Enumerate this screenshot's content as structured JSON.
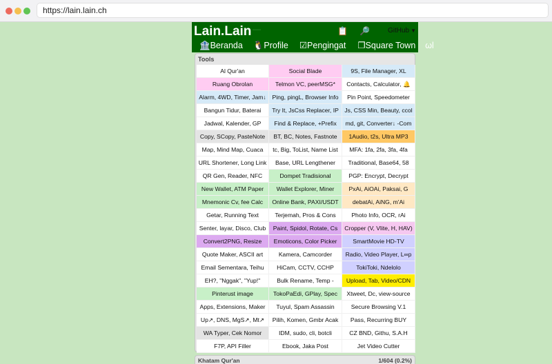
{
  "browser": {
    "url": "https://lain.lain.ch",
    "dots": [
      "#ed6a5e",
      "#f5bf4f",
      "#61c554"
    ]
  },
  "header": {
    "brand": "Lain.Lain",
    "brand_dash": "—",
    "clipboard_icon": "📋",
    "search_icon": "🔎",
    "select_value": "GitHub"
  },
  "nav": [
    {
      "label": "🏦Beranda"
    },
    {
      "label": "🐧Profile"
    },
    {
      "label": "☑Pengingat"
    },
    {
      "label": "❐Square Town"
    },
    {
      "label": "ωl"
    }
  ],
  "tools": {
    "title": "Tools",
    "cells": [
      {
        "label": "Al Qur'an",
        "color": "#ffffff"
      },
      {
        "label": "Social Blade",
        "color": "#ffccf2"
      },
      {
        "label": "9S, File Manager, XL",
        "color": "#d6eaf8"
      },
      {
        "label": "Ruang Obrolan",
        "color": "#ffccf2"
      },
      {
        "label": "Telmon VC, peerMSG*",
        "color": "#ffccf2"
      },
      {
        "label": "Contacts, Calculator, 🔔",
        "color": "#ffffff"
      },
      {
        "label": "Alarm, 4WD, Timer, Jam↓",
        "color": "#d6eaf8"
      },
      {
        "label": "Ping, pingL, Browser Info",
        "color": "#d6eaf8"
      },
      {
        "label": "Pin Point, Speedometer",
        "color": "#ffffff"
      },
      {
        "label": "Bangun Tidur, Baterai",
        "color": "#ffffff"
      },
      {
        "label": "Try It, JsCss Replacer, IP",
        "color": "#d6eaf8"
      },
      {
        "label": "Js, CSS Min, Beauty, ccol",
        "color": "#d6eaf8"
      },
      {
        "label": "Jadwal, Kalender, GP",
        "color": "#ffffff"
      },
      {
        "label": "Find & Replace, +Prefix",
        "color": "#d6eaf8"
      },
      {
        "label": "md, git, Converter↓ -Com",
        "color": "#d6eaf8"
      },
      {
        "label": "Copy, SCopy, PasteNote",
        "color": "#e4e4e4"
      },
      {
        "label": "BT, BC, Notes, Fastnote",
        "color": "#e4e4e4"
      },
      {
        "label": "1Audio, t2s, Ultra MP3",
        "color": "#ffc864"
      },
      {
        "label": "Map, Mind Map, Cuaca",
        "color": "#ffffff"
      },
      {
        "label": "tc, Big, ToList, Name List",
        "color": "#ffffff"
      },
      {
        "label": "MFA: 1fa, 2fa, 3fa, 4fa",
        "color": "#ffffff"
      },
      {
        "label": "URL Shortener, Long Link",
        "color": "#ffffff"
      },
      {
        "label": "Base, URL Lengthener",
        "color": "#ffffff"
      },
      {
        "label": "Traditional, Base64, 58",
        "color": "#ffffff"
      },
      {
        "label": "QR Gen, Reader, NFC",
        "color": "#ffffff"
      },
      {
        "label": "Dompet Tradisional",
        "color": "#c8f0c8"
      },
      {
        "label": "PGP: Encrypt, Decrypt",
        "color": "#ffffff"
      },
      {
        "label": "New Wallet, ATM Paper",
        "color": "#c8f0c8"
      },
      {
        "label": "Wallet Explorer, Miner",
        "color": "#c8f0c8"
      },
      {
        "label": "PxAi, AiOAi, Paksai, G",
        "color": "#ffe8c4"
      },
      {
        "label": "Mnemonic Cv, fee Calc",
        "color": "#c8f0c8"
      },
      {
        "label": "Online Bank, PAXI/USDT",
        "color": "#c8f0c8"
      },
      {
        "label": "debatAi, AiNG, m'Ai",
        "color": "#ffe8c4"
      },
      {
        "label": "Getar, Running Text",
        "color": "#ffffff"
      },
      {
        "label": "Terjemah, Pros & Cons",
        "color": "#ffffff"
      },
      {
        "label": "Photo Info, OCR, rAi",
        "color": "#ffffff"
      },
      {
        "label": "Senter, layar, Disco, Club",
        "color": "#ffffff"
      },
      {
        "label": "Paint, Spidol, Rotate, Cs",
        "color": "#dcaaf0"
      },
      {
        "label": "Cropper (V, Vlite, H, HAV)",
        "color": "#f6c8f0"
      },
      {
        "label": "Convert2PNG, Resize",
        "color": "#dcaaf0"
      },
      {
        "label": "Emoticons, Color Picker",
        "color": "#dcaaf0"
      },
      {
        "label": "SmartMovie HD-TV",
        "color": "#d0d0ff"
      },
      {
        "label": "Quote Maker, ASCII art",
        "color": "#ffffff"
      },
      {
        "label": "Kamera, Camcorder",
        "color": "#ffffff"
      },
      {
        "label": "Radio, Video Player, L∞p",
        "color": "#d0d0ff"
      },
      {
        "label": "Email Sementara, Teihu",
        "color": "#ffffff"
      },
      {
        "label": "HiCam, CCTV, CCHP",
        "color": "#ffffff"
      },
      {
        "label": "TokiToki, Ndelolo",
        "color": "#d0d0ff"
      },
      {
        "label": "EH?, \"Nggak\", \"Yup!\"",
        "color": "#ffffff"
      },
      {
        "label": "Bulk Rename, Temp -",
        "color": "#ffffff"
      },
      {
        "label": "Upload, Tab, Video/CDN",
        "color": "#ffee00"
      },
      {
        "label": "Pinterust image",
        "color": "#c8f0c8"
      },
      {
        "label": "TokoPaEdi, GPlay, Spec",
        "color": "#c8f0c8"
      },
      {
        "label": "Xtweet, Dc, view-source",
        "color": "#ffffff"
      },
      {
        "label": "Apps, Extensions, Maker",
        "color": "#ffffff"
      },
      {
        "label": "Tuyul, Spam Assassin",
        "color": "#ffffff"
      },
      {
        "label": "Secure Browsing V.1",
        "color": "#ffffff"
      },
      {
        "label": "Up↗, DNS, MgS↗, Mt↗",
        "color": "#ffffff"
      },
      {
        "label": "Pilih, Komen, Gmbr Acak",
        "color": "#ffffff"
      },
      {
        "label": "Pass, Recurring BUY",
        "color": "#ffffff"
      },
      {
        "label": "WA Typer, Cek Nomor",
        "color": "#e4e4e4"
      },
      {
        "label": "IDM, sudo, cli, botcli",
        "color": "#ffffff"
      },
      {
        "label": "CZ BND, Githu, S.A.H",
        "color": "#ffffff"
      },
      {
        "label": "F7P, API Filler",
        "color": "#ffffff"
      },
      {
        "label": "Ebook, Jaka Post",
        "color": "#ffffff"
      },
      {
        "label": "Jet Video Cutter",
        "color": "#ffffff"
      }
    ]
  },
  "footer": {
    "title": "Khatam Qur'an",
    "progress": "1/604 (0.2%)"
  }
}
